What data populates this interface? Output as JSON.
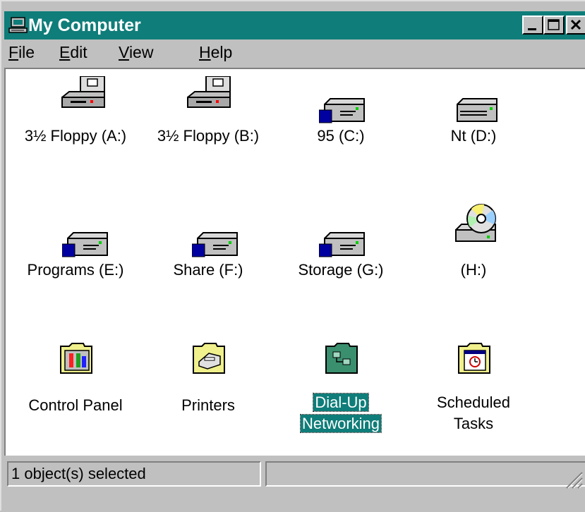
{
  "window": {
    "title": "My Computer",
    "title_bar_color": "#0f7d79"
  },
  "menu": [
    {
      "accel": "F",
      "rest": "ile"
    },
    {
      "accel": "E",
      "rest": "dit"
    },
    {
      "accel": "V",
      "rest": "iew"
    },
    {
      "accel": "H",
      "rest": "elp"
    }
  ],
  "items": [
    {
      "label": "3½ Floppy (A:)",
      "icon": "floppy-drive-icon"
    },
    {
      "label": "3½ Floppy (B:)",
      "icon": "floppy-drive-icon"
    },
    {
      "label": "95 (C:)",
      "icon": "hard-drive-icon"
    },
    {
      "label": "Nt (D:)",
      "icon": "hard-drive-icon"
    },
    {
      "label": "Programs (E:)",
      "icon": "hard-drive-icon"
    },
    {
      "label": "Share (F:)",
      "icon": "hard-drive-icon"
    },
    {
      "label": "Storage (G:)",
      "icon": "hard-drive-icon"
    },
    {
      "label": "(H:)",
      "icon": "cd-drive-icon"
    },
    {
      "label": "Control Panel",
      "icon": "control-panel-folder-icon"
    },
    {
      "label": "Printers",
      "icon": "printers-folder-icon"
    },
    {
      "label_line1": "Dial-Up",
      "label_line2": "Networking",
      "icon": "dialup-networking-folder-icon",
      "selected": true
    },
    {
      "label_line1": "Scheduled",
      "label_line2": "Tasks",
      "icon": "scheduled-tasks-folder-icon"
    }
  ],
  "status": {
    "text": "1 object(s) selected"
  }
}
